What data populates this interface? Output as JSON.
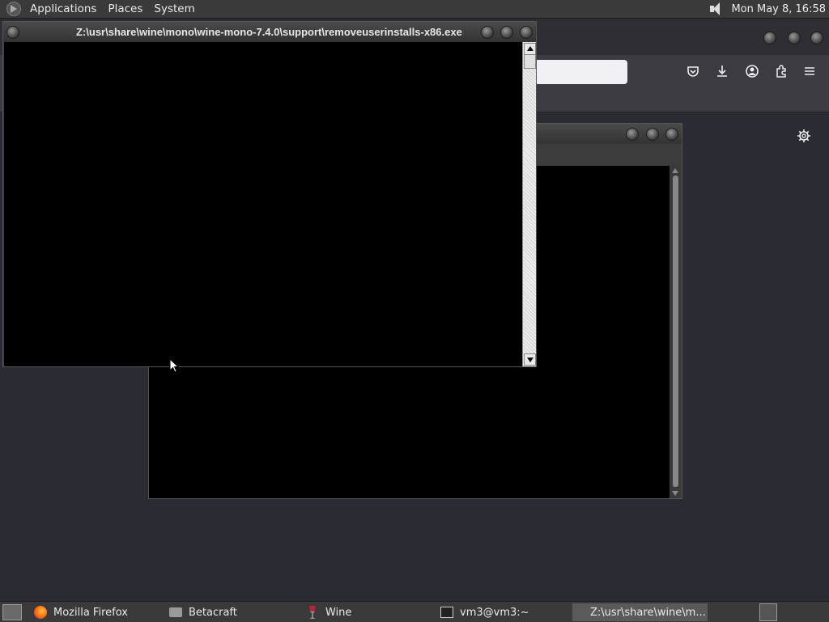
{
  "top_panel": {
    "menus": [
      "Applications",
      "Places",
      "System"
    ],
    "clock": "Mon May  8, 16:58"
  },
  "front_window": {
    "title": "Z:\\usr\\share\\wine\\mono\\wine-mono-7.4.0\\support\\removeuserinstalls-x86.exe"
  },
  "taskbar": {
    "tasks": [
      {
        "label": "Mozilla Firefox",
        "icon": "firefox-icon"
      },
      {
        "label": "Betacraft",
        "icon": "folder-icon"
      },
      {
        "label": "Wine",
        "icon": "wine-icon"
      },
      {
        "label": "vm3@vm3:~",
        "icon": "terminal-icon"
      },
      {
        "label": "Z:\\usr\\share\\wine\\m...",
        "icon": "wine-icon"
      }
    ]
  },
  "icons": {
    "firefox_toolbar": [
      "pocket-icon",
      "download-icon",
      "account-icon",
      "extensions-icon",
      "menu-icon"
    ],
    "settings": "gear-icon"
  }
}
